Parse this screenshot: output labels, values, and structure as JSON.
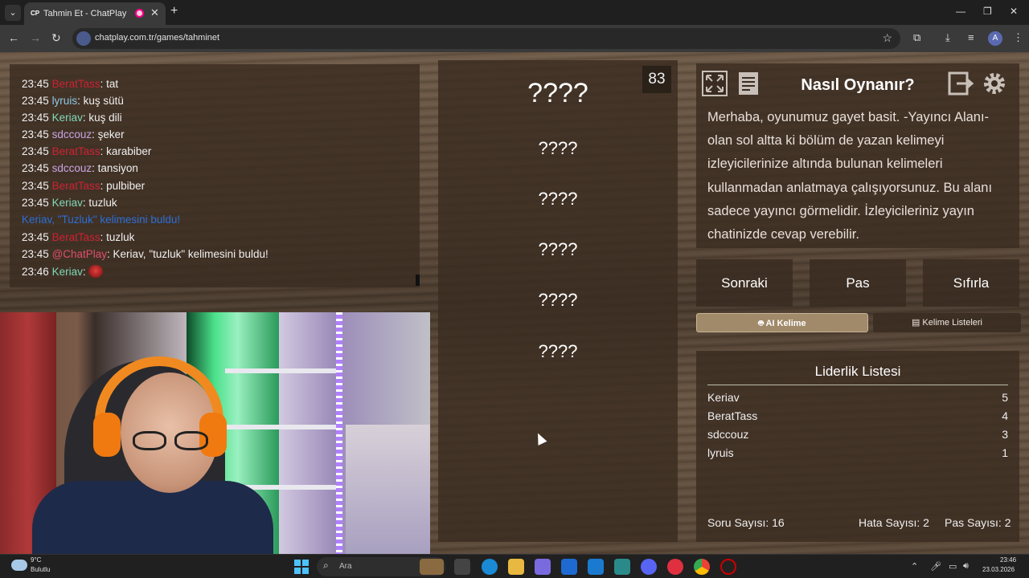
{
  "browser": {
    "tab_title": "Tahmin Et - ChatPlay",
    "tab_favicon": "CP",
    "url": "chatplay.com.tr/games/tahminet",
    "profile_initial": "A"
  },
  "chat": {
    "lines": [
      {
        "time": "23:45",
        "user": "BeratTass",
        "user_color": "#cc2233",
        "text": ": tat"
      },
      {
        "time": "23:45",
        "user": "lyruis",
        "user_color": "#8ec9e8",
        "text": ": kuş sütü"
      },
      {
        "time": "23:45",
        "user": "Keriav",
        "user_color": "#7fd9b9",
        "text": ": kuş dili"
      },
      {
        "time": "23:45",
        "user": "sdccouz",
        "user_color": "#c9a4e4",
        "text": ": şeker"
      },
      {
        "time": "23:45",
        "user": "BeratTass",
        "user_color": "#cc2233",
        "text": ": karabiber"
      },
      {
        "time": "23:45",
        "user": "sdccouz",
        "user_color": "#c9a4e4",
        "text": ": tansiyon"
      },
      {
        "time": "23:45",
        "user": "BeratTass",
        "user_color": "#cc2233",
        "text": ": pulbiber"
      },
      {
        "time": "23:45",
        "user": "Keriav",
        "user_color": "#7fd9b9",
        "text": ": tuzluk"
      },
      {
        "time": "",
        "user": "",
        "user_color": "#2b6fd6",
        "text": "Keriav, \"Tuzluk\" kelimesini buldu!",
        "system": true
      },
      {
        "time": "23:45",
        "user": "BeratTass",
        "user_color": "#cc2233",
        "text": ": tuzluk"
      },
      {
        "time": "23:45",
        "user": "@ChatPlay",
        "user_color": "#e0506a",
        "text": ": Keriav, \"tuzluk\" kelimesini buldu!"
      },
      {
        "time": "23:46",
        "user": "Keriav",
        "user_color": "#7fd9b9",
        "text": ": "
      }
    ]
  },
  "game": {
    "timer": "83",
    "words": [
      "????",
      "????",
      "????",
      "????",
      "????",
      "????"
    ]
  },
  "howto": {
    "title": "Nasıl Oynanır?",
    "text": "Merhaba, oyunumuz gayet basit. -Yayıncı Alanı- olan sol altta ki bölüm de yazan kelimeyi izleyicilerinize altında bulunan kelimeleri kullanmadan anlatmaya çalışıyorsunuz. Bu alanı sadece yayıncı görmelidir. İzleyicileriniz yayın chatinizde cevap verebilir."
  },
  "controls": {
    "next": "Sonraki",
    "pass": "Pas",
    "reset": "Sıfırla",
    "ai_tab": "AI Kelime",
    "list_tab": "Kelime Listeleri"
  },
  "leaderboard": {
    "title": "Liderlik Listesi",
    "rows": [
      {
        "name": "Keriav",
        "score": "5"
      },
      {
        "name": "BeratTass",
        "score": "4"
      },
      {
        "name": "sdccouz",
        "score": "3"
      },
      {
        "name": "lyruis",
        "score": "1"
      }
    ],
    "question_count": "Soru Sayısı: 16",
    "error_count": "Hata Sayısı: 2",
    "pass_count": "Pas Sayısı: 2"
  },
  "taskbar": {
    "temp": "9°C",
    "weather": "Bulutlu",
    "search_placeholder": "Ara",
    "time": "23:46",
    "date": "23.03.2026"
  }
}
